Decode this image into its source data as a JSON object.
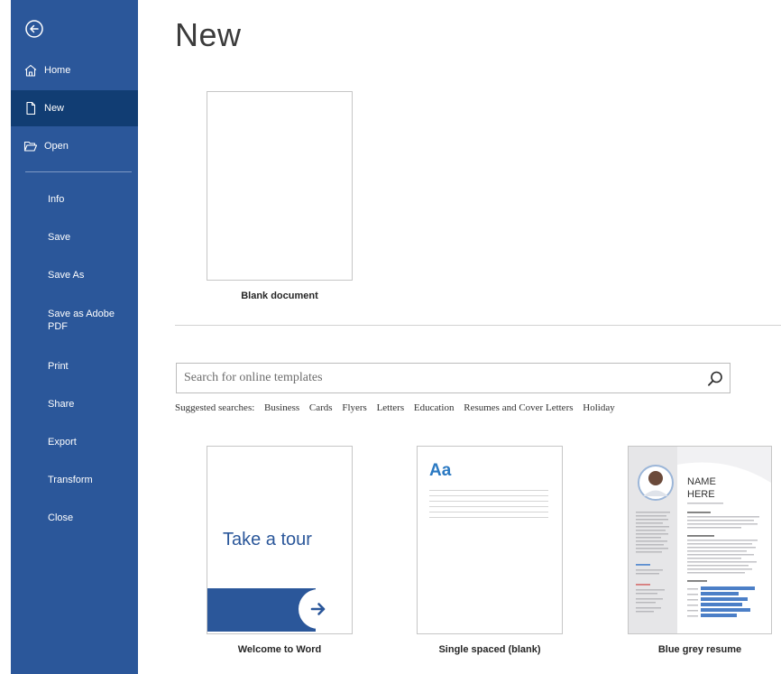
{
  "sidebar": {
    "nav": [
      {
        "label": "Home",
        "icon": "home-icon"
      },
      {
        "label": "New",
        "icon": "new-document-icon",
        "active": true
      },
      {
        "label": "Open",
        "icon": "open-folder-icon"
      }
    ],
    "items": [
      "Info",
      "Save",
      "Save As",
      "Save as Adobe PDF",
      "Print",
      "Share",
      "Export",
      "Transform",
      "Close"
    ]
  },
  "main": {
    "title": "New",
    "blank": {
      "caption": "Blank document"
    },
    "search": {
      "placeholder": "Search for online templates"
    },
    "suggested": {
      "label": "Suggested searches:",
      "links": [
        "Business",
        "Cards",
        "Flyers",
        "Letters",
        "Education",
        "Resumes and Cover Letters",
        "Holiday"
      ]
    },
    "templates": [
      {
        "caption": "Welcome to Word",
        "text": "Take a tour"
      },
      {
        "caption": "Single spaced (blank)",
        "text": "Aa"
      },
      {
        "caption": "Blue grey resume",
        "name_line1": "NAME",
        "name_line2": "HERE"
      }
    ]
  },
  "colors": {
    "accent": "#2b579a",
    "active": "#113d73"
  }
}
